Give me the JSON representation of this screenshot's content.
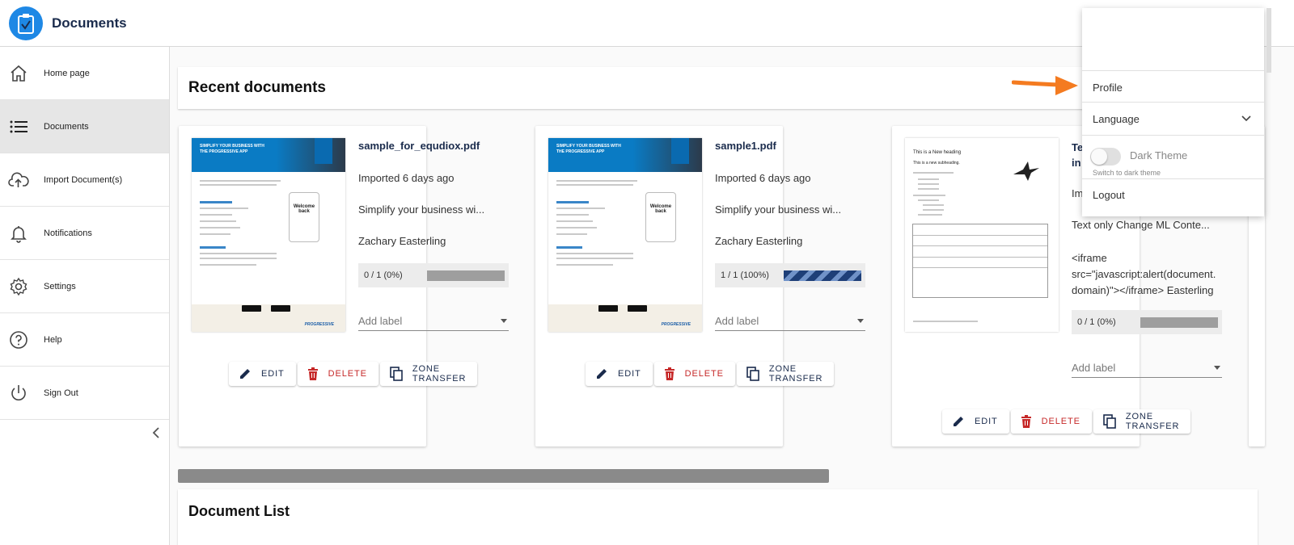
{
  "app": {
    "title": "Documents"
  },
  "sidebar": {
    "items": [
      {
        "label": "Home page",
        "icon": "home-icon"
      },
      {
        "label": "Documents",
        "icon": "list-icon",
        "active": true
      },
      {
        "label": "Import Document(s)",
        "icon": "cloud-upload-icon"
      },
      {
        "label": "Notifications",
        "icon": "bell-icon"
      },
      {
        "label": "Settings",
        "icon": "gear-icon"
      },
      {
        "label": "Help",
        "icon": "help-circle-icon"
      },
      {
        "label": "Sign Out",
        "icon": "power-icon"
      }
    ]
  },
  "recent": {
    "title": "Recent documents"
  },
  "cards": [
    {
      "file_name": "sample_for_equdiox.pdf",
      "imported": "Imported 6 days ago",
      "description": "Simplify your business wi...",
      "owner": "Zachary Easterling",
      "progress_text": "0 / 1 (0%)",
      "progress": 0,
      "label_placeholder": "Add label",
      "thumb": {
        "banner": "SIMPLIFY YOUR BUSINESS WITH THE PROGRESSIVE APP",
        "phone": "Welcome back",
        "brand": "PROGRESSIVE"
      }
    },
    {
      "file_name": "sample1.pdf",
      "imported": "Imported 6 days ago",
      "description": "Simplify your business wi...",
      "owner": "Zachary Easterling",
      "progress_text": "1 / 1 (100%)",
      "progress": 1,
      "label_placeholder": "Add label",
      "thumb": {
        "banner": "SIMPLIFY YOUR BUSINESS WITH THE PROGRESSIVE APP",
        "phone": "Welcome back",
        "brand": "PROGRESSIVE"
      }
    },
    {
      "file_name_line1": "Te",
      "file_name_line2": "in",
      "imported": "Im",
      "description": "Text only Change ML Conte...",
      "owner_line1": "<iframe",
      "owner_line2": "src=\"javascript:alert(document.",
      "owner_line3": "domain)\"></iframe> Easterling",
      "progress_text": "0 / 1 (0%)",
      "progress": 0,
      "label_placeholder": "Add label",
      "thumb": {
        "heading": "This is a New heading",
        "subheading": "This is a new subheading."
      }
    }
  ],
  "actions": {
    "edit": "EDIT",
    "delete": "DELETE",
    "zone_transfer": "ZONE TRANSFER"
  },
  "document_list": {
    "title": "Document List"
  },
  "menu": {
    "profile": "Profile",
    "language": "Language",
    "dark_theme": "Dark Theme",
    "dark_theme_hint": "Switch to dark theme",
    "dark_theme_on": false,
    "logout": "Logout"
  },
  "colors": {
    "accent": "#1e88e5",
    "navy": "#1a2b4c",
    "danger": "#c62828",
    "arrow": "#f47b20"
  }
}
